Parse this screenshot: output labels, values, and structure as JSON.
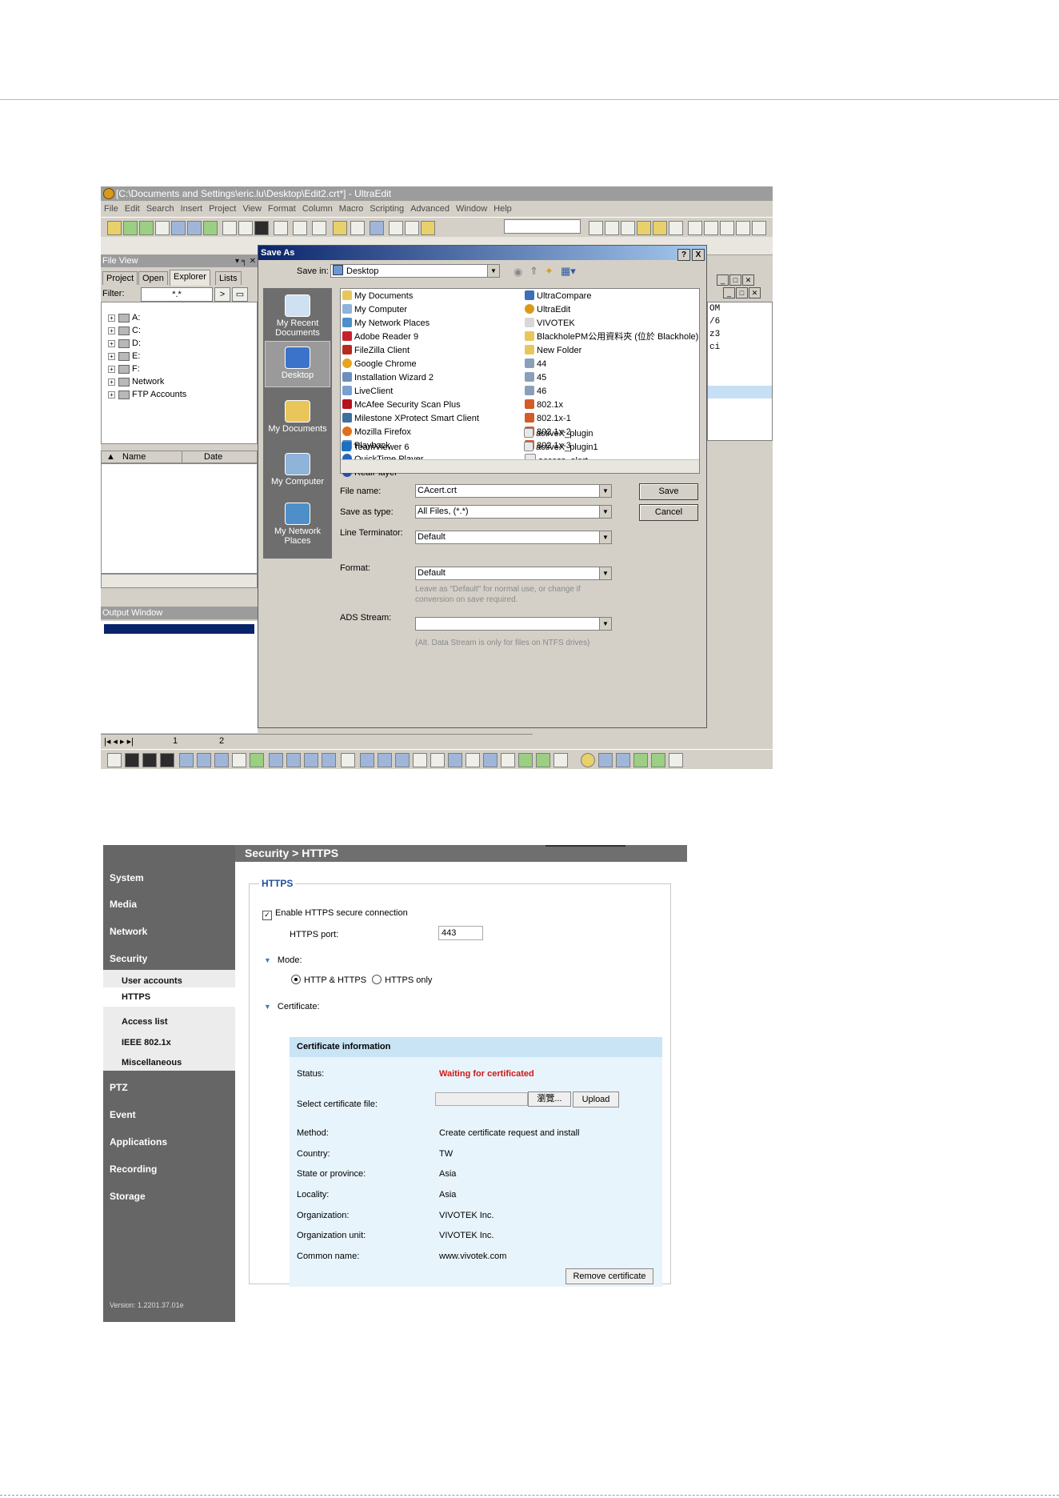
{
  "ultraedit": {
    "window_title": "[C:\\Documents and Settings\\eric.lu\\Desktop\\Edit2.crt*] - UltraEdit",
    "menu": [
      "File",
      "Edit",
      "Search",
      "Insert",
      "Project",
      "View",
      "Format",
      "Column",
      "Macro",
      "Scripting",
      "Advanced",
      "Window",
      "Help"
    ],
    "file_view": {
      "title": "File View",
      "tabs": [
        "Project",
        "Open",
        "Explorer",
        "Lists"
      ],
      "active_tab": "Explorer",
      "filter_label": "Filter:",
      "filter_value": "*.*",
      "filter_go": ">",
      "tree": [
        "A:",
        "C:",
        "D:",
        "E:",
        "F:",
        "Network",
        "FTP Accounts"
      ],
      "list_columns": [
        "Name",
        "Date modified"
      ]
    },
    "output_window_title": "Output Window",
    "editor_lines": [
      "OM",
      "/6",
      "z3",
      "ci"
    ],
    "doc_tabs": [
      "1",
      "2"
    ]
  },
  "save_as": {
    "title": "Save As",
    "title_buttons": [
      "?",
      "X"
    ],
    "save_in_label": "Save in:",
    "save_in_value": "Desktop",
    "places": [
      "My Recent Documents",
      "Desktop",
      "My Documents",
      "My Computer",
      "My Network Places"
    ],
    "selected_place": "Desktop",
    "files_col1": [
      "My Documents",
      "My Computer",
      "My Network Places",
      "Adobe Reader 9",
      "FileZilla Client",
      "Google Chrome",
      "Installation Wizard 2",
      "LiveClient",
      "McAfee Security Scan Plus",
      "Milestone XProtect Smart Client",
      "Mozilla Firefox",
      "Playback",
      "QuickTime Player",
      "RealPlayer",
      "TeamViewer 6"
    ],
    "files_col2": [
      "UltraCompare",
      "UltraEdit",
      "VIVOTEK",
      "BlackholePM公用資料夾 (位於 Blackhole)",
      "New Folder",
      "44",
      "45",
      "46",
      "802.1x",
      "802.1x-1",
      "802.1x-2",
      "802.1x-3",
      "access_alert",
      "activeX_plugin",
      "activeX_plugin1"
    ],
    "file_name_label": "File name:",
    "file_name_value": "CAcert.crt",
    "save_as_type_label": "Save as type:",
    "save_as_type_value": "All Files, (*.*)",
    "line_terminator_label": "Line Terminator:",
    "line_terminator_value": "Default",
    "format_label": "Format:",
    "format_value": "Default",
    "format_hint": "Leave as \"Default\" for normal use, or change if conversion on save required.",
    "ads_label": "ADS Stream:",
    "ads_value": "",
    "ads_hint": "(Alt. Data Stream is only for files on NTFS drives)",
    "save_button": "Save",
    "cancel_button": "Cancel"
  },
  "vivotek": {
    "breadcrumb": "Security  > HTTPS",
    "nav": [
      "System",
      "Media",
      "Network",
      "Security",
      "PTZ",
      "Event",
      "Applications",
      "Recording",
      "Storage"
    ],
    "security_sub": [
      "User accounts",
      "HTTPS",
      "Access list",
      "IEEE 802.1x",
      "Miscellaneous"
    ],
    "active_sub": "HTTPS",
    "version": "Version: 1.2201.37.01e",
    "section_title": "HTTPS",
    "enable_label": "Enable HTTPS secure connection",
    "enable_checked": true,
    "port_label": "HTTPS port:",
    "port_value": "443",
    "mode_label": "Mode:",
    "mode_options": [
      "HTTP & HTTPS",
      "HTTPS only"
    ],
    "mode_selected": "HTTP & HTTPS",
    "certificate_label": "Certificate:",
    "cert_info_title": "Certificate information",
    "status_label": "Status:",
    "status_value": "Waiting for certificated",
    "select_file_label": "Select certificate file:",
    "browse_button": "瀏覽...",
    "upload_button": "Upload",
    "fields": [
      {
        "label": "Method:",
        "value": "Create certificate request and install"
      },
      {
        "label": "Country:",
        "value": "TW"
      },
      {
        "label": "State or province:",
        "value": "Asia"
      },
      {
        "label": "Locality:",
        "value": "Asia"
      },
      {
        "label": "Organization:",
        "value": "VIVOTEK Inc."
      },
      {
        "label": "Organization unit:",
        "value": "VIVOTEK Inc."
      },
      {
        "label": "Common name:",
        "value": "www.vivotek.com"
      }
    ],
    "remove_button": "Remove certificate"
  }
}
